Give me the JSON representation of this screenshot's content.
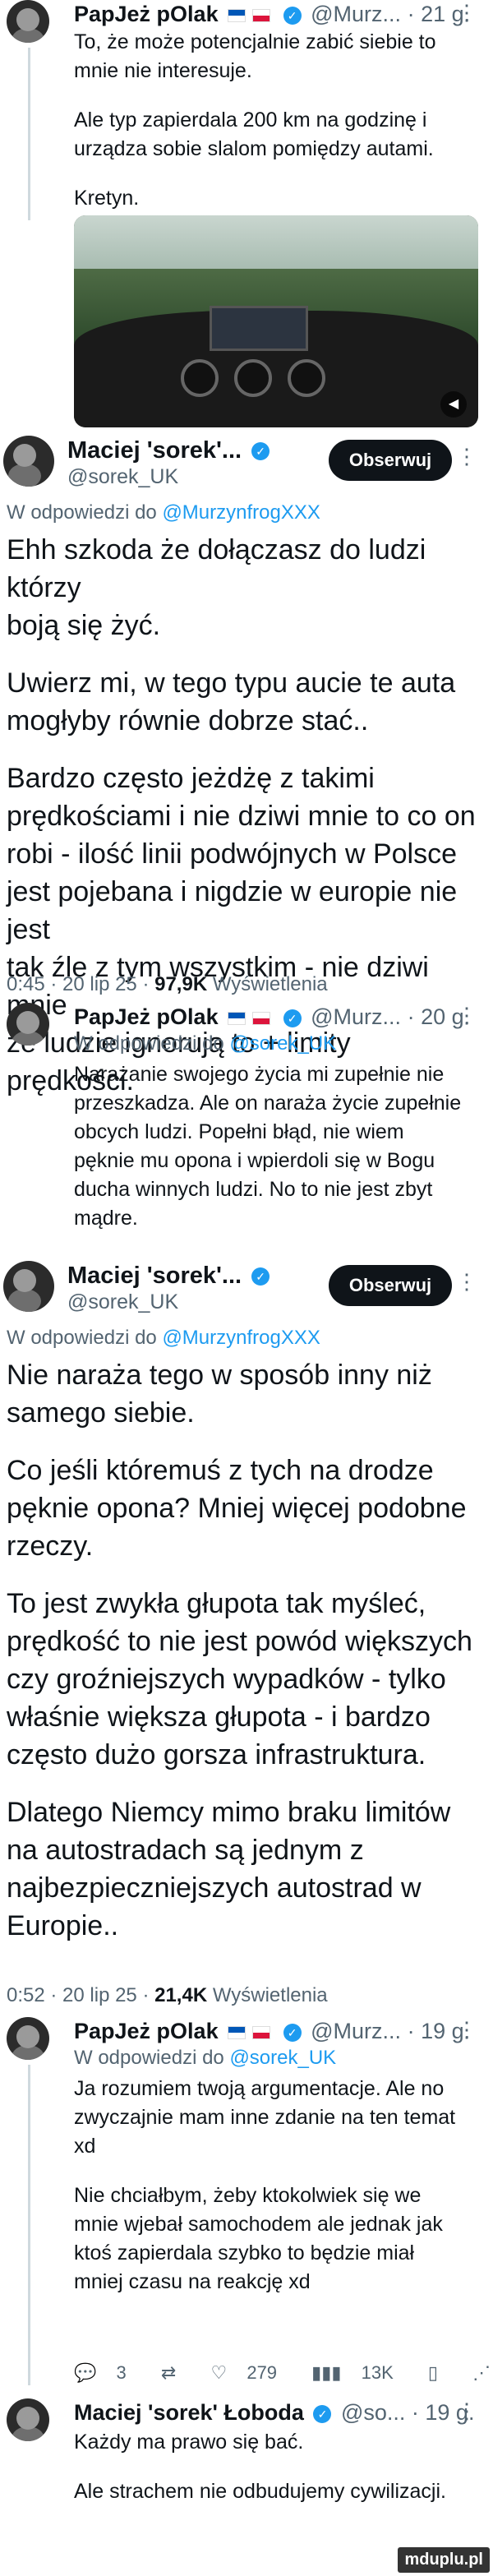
{
  "post1": {
    "name": "PapJeż pOlak",
    "handle": "@Murz...",
    "time": "· 21 g.",
    "text_1": "To, że może potencjalnie zabić siebie to",
    "text_2": "mnie nie interesuje.",
    "text_3": "Ale typ  zapierdala 200 km na godzinę i",
    "text_4": "urządza sobie slalom pomiędzy autami.",
    "text_5": "Kretyn."
  },
  "post2": {
    "name": "Maciej 'sorek'...",
    "handle": "@sorek_UK",
    "follow_label": "Obserwuj",
    "reply_prefix": "W odpowiedzi do",
    "reply_handle": "@MurzynfrogXXX",
    "lines": [
      "Ehh szkoda że dołączasz do ludzi którzy",
      "boją się żyć.",
      "",
      "Uwierz mi, w tego typu aucie te auta",
      "mogłyby równie dobrze stać..",
      "",
      "Bardzo często jeżdżę z takimi",
      "prędkościami i nie dziwi mnie to co on",
      "robi - ilość linii podwójnych w Polsce",
      "jest pojebana i nigdzie w europie nie jest",
      "tak źle z tym wszystkim - nie dziwi mnie",
      "że ludzie ignorują to + limity prędkości."
    ],
    "time": "0:45 · 20 lip 25 ·",
    "views": "97,9K",
    "views_label": "Wyświetlenia"
  },
  "post3": {
    "name": "PapJeż pOlak",
    "handle": "@Murz...",
    "time": "· 20 g.",
    "reply_prefix": "W odpowiedzi do",
    "reply_handle": "@sorek_UK",
    "lines": [
      "Narażanie swojego życia mi zupełnie nie",
      "przeszkadza. Ale on naraża życie zupełnie",
      "obcych ludzi. Popełni błąd, nie wiem",
      "pęknie mu opona i wpierdoli się w Bogu",
      "ducha winnych ludzi. No to nie jest zbyt",
      "mądre."
    ]
  },
  "post4": {
    "name": "Maciej 'sorek'...",
    "handle": "@sorek_UK",
    "follow_label": "Obserwuj",
    "reply_prefix": "W odpowiedzi do",
    "reply_handle": "@MurzynfrogXXX",
    "lines": [
      "Nie naraża tego w sposób inny niż",
      "samego siebie.",
      "",
      "Co jeśli któremuś z tych na drodze",
      "pęknie opona? Mniej więcej podobne",
      "rzeczy.",
      "",
      "To jest zwykła głupota tak myśleć,",
      "prędkość to nie jest powód większych",
      "czy groźniejszych wypadków - tylko",
      "właśnie większa głupota - i bardzo",
      "często dużo gorsza infrastruktura.",
      "",
      "Dlatego Niemcy mimo braku limitów",
      "na autostradach są jednym z",
      "najbezpieczniejszych autostrad w",
      "Europie.."
    ],
    "time": "0:52 · 20 lip 25 ·",
    "views": "21,4K",
    "views_label": "Wyświetlenia"
  },
  "post5": {
    "name": "PapJeż pOlak",
    "handle": "@Murz...",
    "time": "· 19 g.",
    "reply_prefix": "W odpowiedzi do",
    "reply_handle": "@sorek_UK",
    "lines": [
      "Ja rozumiem twoją argumentacje. Ale no",
      "zwyczajnie mam inne zdanie na ten temat",
      "xd",
      "",
      "Nie chciałbym, żeby ktokolwiek się we",
      "mnie wjebał samochodem ale jednak jak",
      "ktoś zapierdala szybko to będzie miał",
      "mniej czasu na reakcję xd"
    ],
    "actions": {
      "replies": "3",
      "likes": "279",
      "views": "13K"
    }
  },
  "post6": {
    "name": "Maciej 'sorek' Łoboda",
    "handle": "@so...",
    "time": "· 19 g.",
    "line_1": "Każdy ma prawo się bać.",
    "line_2": "Ale strachem nie odbudujemy cywilizacji."
  },
  "watermark": "mduplu.pl"
}
